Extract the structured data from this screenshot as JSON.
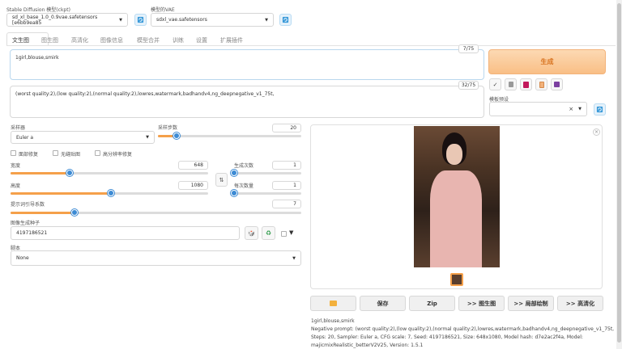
{
  "header": {
    "ckpt_label": "Stable Diffusion 模型(ckpt)",
    "ckpt_value": "sd_xl_base_1.0_0.9vae.safetensors [e6bb9ea85",
    "vae_label": "模型的VAE",
    "vae_value": "sdxl_vae.safetensors"
  },
  "tabs": [
    "文生图",
    "图生图",
    "高清化",
    "图像信息",
    "模型合并",
    "训练",
    "设置",
    "扩展插件"
  ],
  "prompt": {
    "positive": "1girl,blouse,smirk",
    "positive_count": "7/75",
    "negative": "(worst quality:2),(low quality:2),(normal quality:2),lowres,watermark,badhandv4,ng_deepnegative_v1_75t,",
    "negative_count": "32/75"
  },
  "generate_label": "生成",
  "styles_label": "模板预设",
  "sampler": {
    "label": "采样器",
    "value": "Euler a",
    "steps_label": "采样步数",
    "steps_value": "20"
  },
  "checkboxes": {
    "face": "面部修复",
    "tiling": "无缝贴图",
    "hires": "高分辨率修复"
  },
  "size": {
    "width_label": "宽度",
    "width_value": "648",
    "height_label": "高度",
    "height_value": "1080",
    "batch_count_label": "生成次数",
    "batch_count_value": "1",
    "batch_size_label": "每次数量",
    "batch_size_value": "1"
  },
  "cfg": {
    "label": "提示词引导系数",
    "value": "7"
  },
  "seed": {
    "label": "图像生成种子",
    "value": "4197186521"
  },
  "script": {
    "label": "脚本",
    "value": "None"
  },
  "output_buttons": {
    "zip": "Zip",
    "save": "保存",
    "to_img2img": ">> 图生图",
    "to_inpaint": ">> 局部绘制",
    "to_extras": ">> 高清化"
  },
  "info": {
    "line1": "1girl,blouse,smirk",
    "line2": "Negative prompt: (worst quality:2),(low quality:2),(normal quality:2),lowres,watermark,badhandv4,ng_deepnegative_v1_75t,",
    "line3": "Steps: 20, Sampler: Euler a, CFG scale: 7, Seed: 4197186521, Size: 648x1080, Model hash: d7e2ac2f4a, Model:",
    "line4": "majicmixRealistic_betterV2V25, Version: 1.5.1"
  },
  "sliders": {
    "steps_fraction": 0.13,
    "width_fraction": 0.3,
    "height_fraction": 0.51,
    "batch_count_fraction": 0.0,
    "batch_size_fraction": 0.0,
    "cfg_fraction": 0.22
  },
  "colors": {
    "generate_bg": "#fbd0a4",
    "accent": "#f5a04a",
    "thumb": "#3d8bd4"
  }
}
